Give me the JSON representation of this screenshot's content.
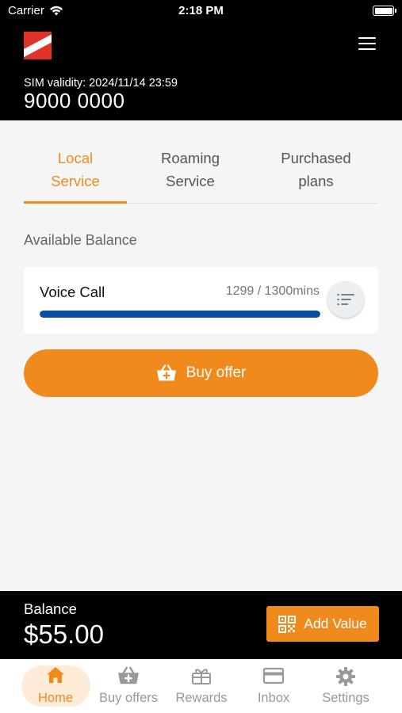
{
  "status_bar": {
    "carrier": "Carrier",
    "time": "2:18 PM"
  },
  "header": {
    "sim_validity": "SIM validity: 2024/11/14 23:59",
    "phone_number": "9000 0000"
  },
  "tabs": [
    {
      "line1": "Local",
      "line2": "Service",
      "active": true
    },
    {
      "line1": "Roaming",
      "line2": "Service",
      "active": false
    },
    {
      "line1": "Purchased",
      "line2": "plans",
      "active": false
    }
  ],
  "balance_section": {
    "title": "Available Balance",
    "item": {
      "name": "Voice Call",
      "value": "1299 / 1300mins",
      "used_fraction": 0.999
    }
  },
  "buy_button": {
    "label": "Buy offer"
  },
  "balance_bar": {
    "label": "Balance",
    "amount": "$55.00",
    "add_value_label": "Add Value"
  },
  "bottom_nav": [
    {
      "label": "Home",
      "icon": "home-icon",
      "active": true
    },
    {
      "label": "Buy offers",
      "icon": "basket-icon",
      "active": false
    },
    {
      "label": "Rewards",
      "icon": "gift-icon",
      "active": false
    },
    {
      "label": "Inbox",
      "icon": "card-icon",
      "active": false
    },
    {
      "label": "Settings",
      "icon": "gear-icon",
      "active": false
    }
  ],
  "colors": {
    "accent": "#f18a1c",
    "progress": "#0a4ea1",
    "header_bg": "#000000",
    "background": "#f5f5f5"
  }
}
